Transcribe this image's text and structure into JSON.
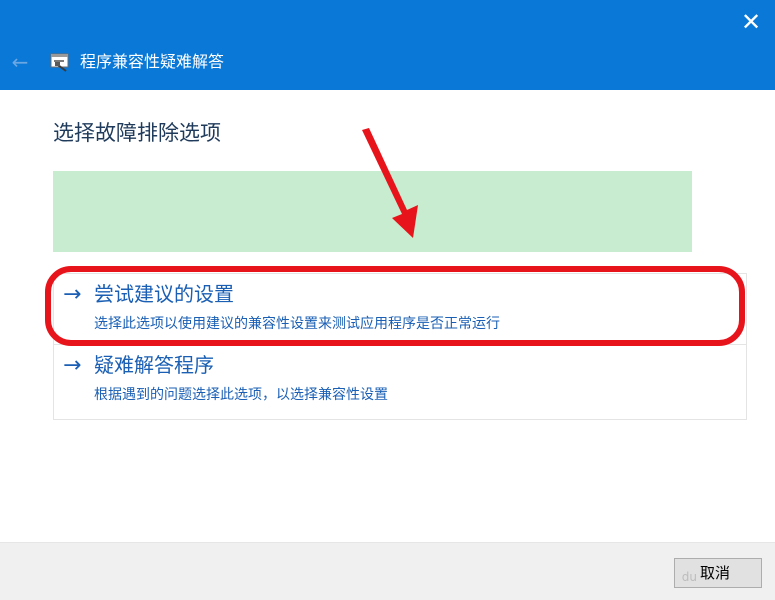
{
  "window": {
    "title": "程序兼容性疑难解答",
    "close_glyph": "✕",
    "back_glyph": "←",
    "icons": {
      "close": "close-icon",
      "back": "back-arrow-icon",
      "app": "compatibility-troubleshooter-icon"
    }
  },
  "main": {
    "heading": "选择故障排除选项",
    "options": [
      {
        "arrow": "→",
        "title": "尝试建议的设置",
        "description": "选择此选项以使用建议的兼容性设置来测试应用程序是否正常运行"
      },
      {
        "arrow": "→",
        "title": "疑难解答程序",
        "description": "根据遇到的问题选择此选项，以选择兼容性设置"
      }
    ]
  },
  "footer": {
    "cancel_label": "取消"
  },
  "watermark": {
    "text": "du"
  },
  "colors": {
    "title_bar": "#0a78d7",
    "link_text": "#1a5fb4",
    "highlight_outline": "#e8141b",
    "annotation_arrow": "#e8141b",
    "green_banner": "#c7ecd0"
  }
}
